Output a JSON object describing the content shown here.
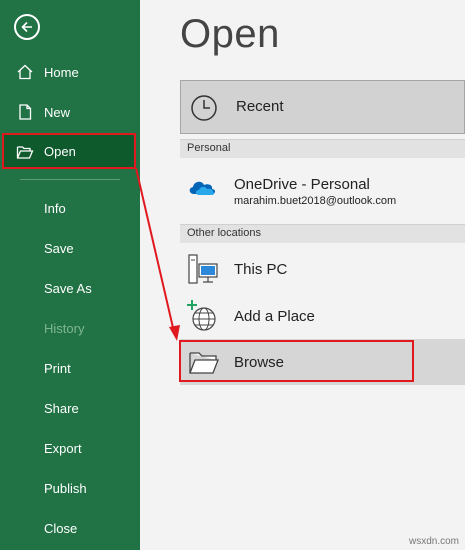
{
  "sidebar": {
    "items": [
      {
        "label": "Home",
        "icon": "home-icon"
      },
      {
        "label": "New",
        "icon": "new-document-icon"
      },
      {
        "label": "Open",
        "icon": "folder-open-icon"
      },
      {
        "label": "Info"
      },
      {
        "label": "Save"
      },
      {
        "label": "Save As"
      },
      {
        "label": "History"
      },
      {
        "label": "Print"
      },
      {
        "label": "Share"
      },
      {
        "label": "Export"
      },
      {
        "label": "Publish"
      },
      {
        "label": "Close"
      }
    ],
    "background_color": "#217346",
    "selected_color": "#0e5a2c",
    "disabled_item": "History"
  },
  "main": {
    "title": "Open",
    "recent_label": "Recent",
    "personal_header": "Personal",
    "onedrive": {
      "name": "OneDrive - Personal",
      "email": "marahim.buet2018@outlook.com"
    },
    "other_header": "Other locations",
    "this_pc_label": "This PC",
    "add_place_label": "Add a Place",
    "browse_label": "Browse"
  },
  "annotation_color": "#e0191f",
  "watermark": "wsxdn.com"
}
